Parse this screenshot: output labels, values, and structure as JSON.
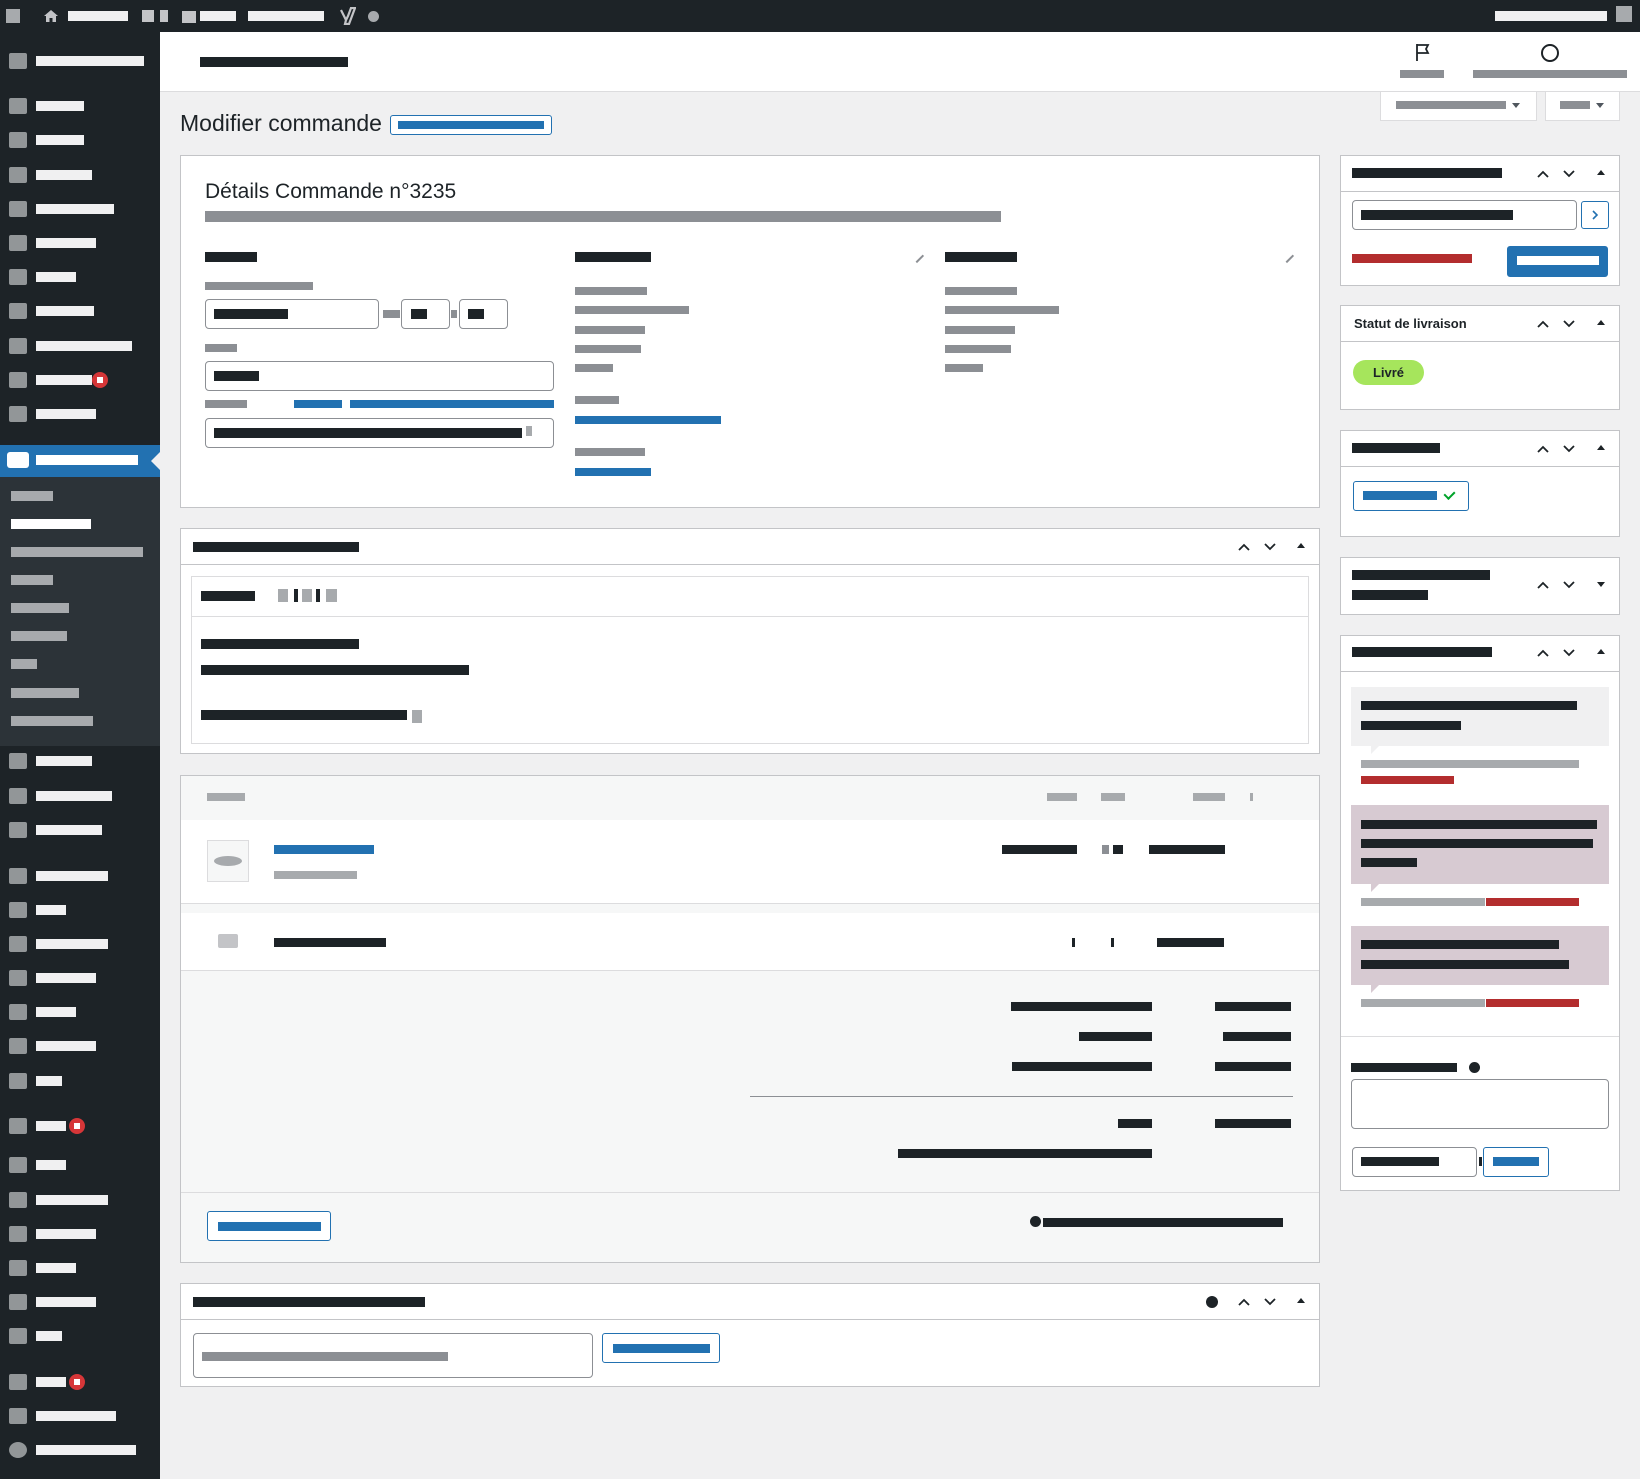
{
  "page": {
    "title": "Modifier commande",
    "order_details_title": "Détails Commande n°3235"
  },
  "shipping_status_box": {
    "title": "Statut de livraison",
    "status": "Livré"
  },
  "colors": {
    "admin_dark": "#1d2327",
    "accent_blue": "#2271b1",
    "status_green": "#c6e1c6",
    "status_green_bg": "#a6e55c",
    "danger_red": "#d63638",
    "note_customer": "#d7cad2"
  },
  "icons": {
    "admin_bar": [
      "wordpress-icon",
      "home-icon",
      "comment-icon",
      "plus-icon",
      "yoast-icon",
      "status-dot-icon"
    ],
    "header": [
      "flag-icon",
      "circle-icon"
    ],
    "sidebar": [
      "dashboard-icon",
      "pin-icon",
      "media-icon",
      "brush-icon",
      "user-icon",
      "page-icon",
      "copy-icon",
      "share-icon",
      "comment-icon",
      "mail-icon",
      "gear-icon",
      "woo-icon",
      "archive-icon",
      "chart-icon",
      "megaphone-icon",
      "hammer-icon",
      "yoast-icon",
      "plug-icon",
      "user-icon",
      "wrench-icon",
      "import-icon",
      "table-icon",
      "yoast-icon",
      "yoast-icon",
      "plug-icon",
      "user-icon",
      "wrench-icon",
      "import-icon",
      "table-icon",
      "yoast-icon",
      "graduation-icon",
      "collapse-icon"
    ]
  }
}
